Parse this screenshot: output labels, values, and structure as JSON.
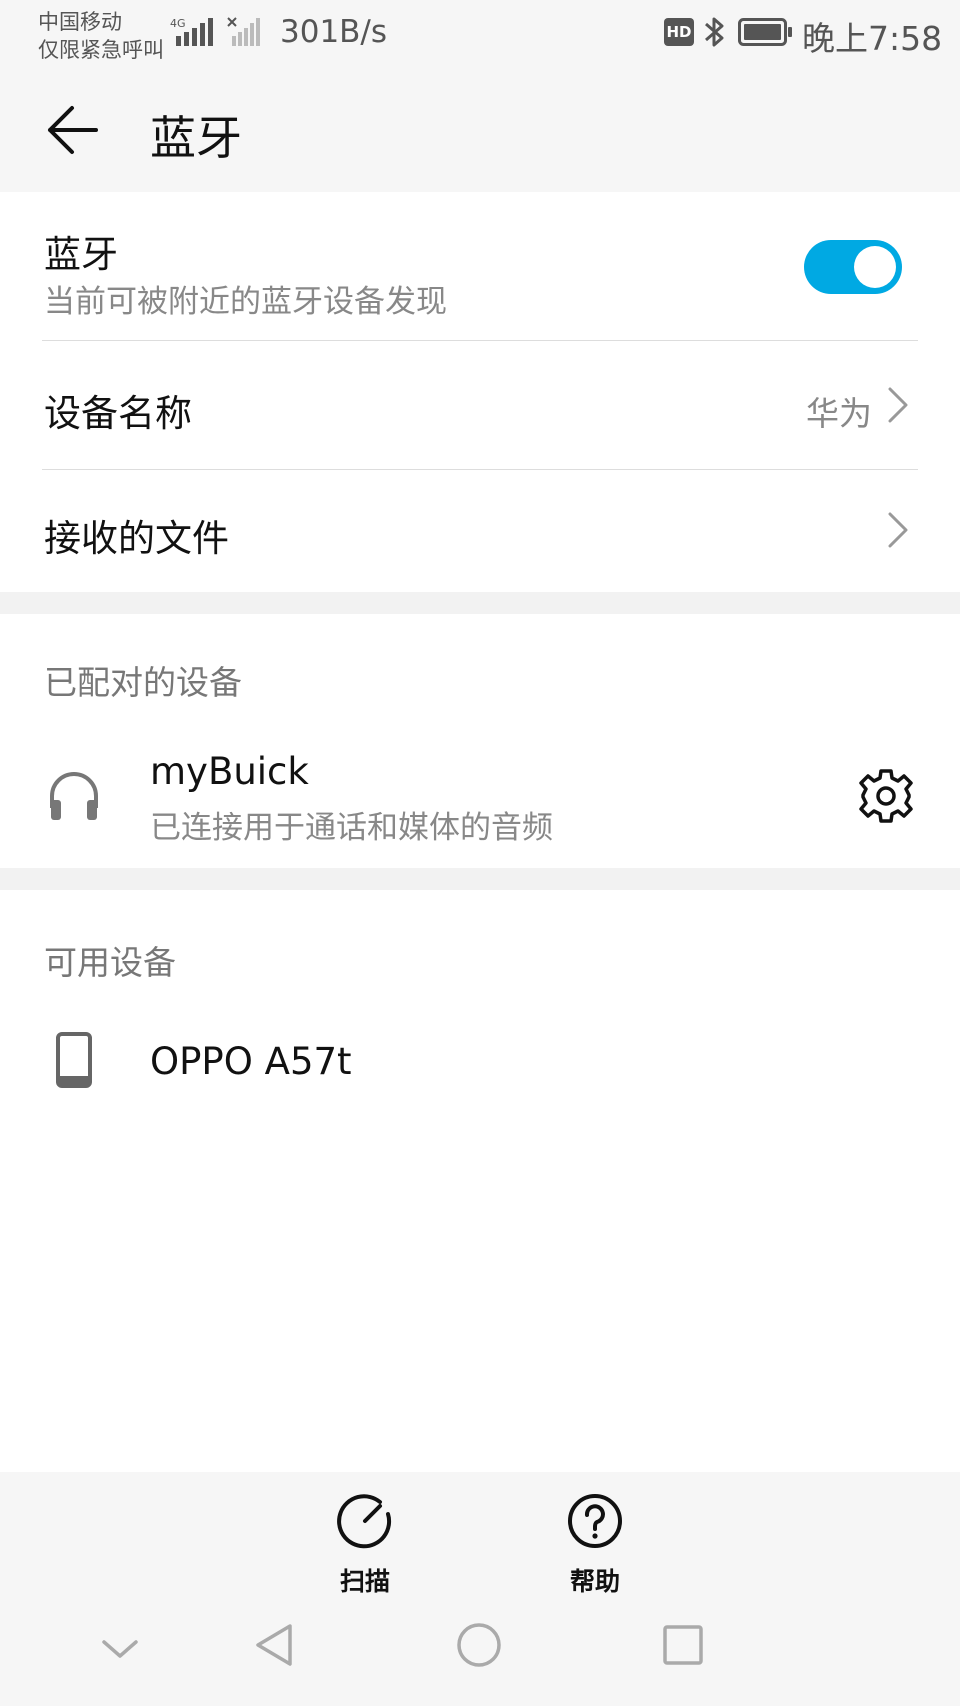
{
  "status_bar": {
    "carrier_line1": "中国移动",
    "carrier_line2": "仅限紧急呼叫",
    "network": "4G",
    "speed": "301B/s",
    "hd": "HD",
    "time": "晚上7:58"
  },
  "header": {
    "title": "蓝牙",
    "back_icon": "arrow-left-icon"
  },
  "bluetooth": {
    "title": "蓝牙",
    "subtitle": "当前可被附近的蓝牙设备发现",
    "enabled": true,
    "toggle_color": "#00a9e3"
  },
  "device_name": {
    "label": "设备名称",
    "value": "华为"
  },
  "received_files": {
    "label": "接收的文件"
  },
  "paired": {
    "section_title": "已配对的设备",
    "devices": [
      {
        "name": "myBuick",
        "status": "已连接用于通话和媒体的音频",
        "icon": "headphones-icon"
      }
    ]
  },
  "available": {
    "section_title": "可用设备",
    "devices": [
      {
        "name": "OPPO A57t",
        "icon": "phone-icon"
      }
    ]
  },
  "bottom_actions": {
    "scan_label": "扫描",
    "help_label": "帮助"
  }
}
